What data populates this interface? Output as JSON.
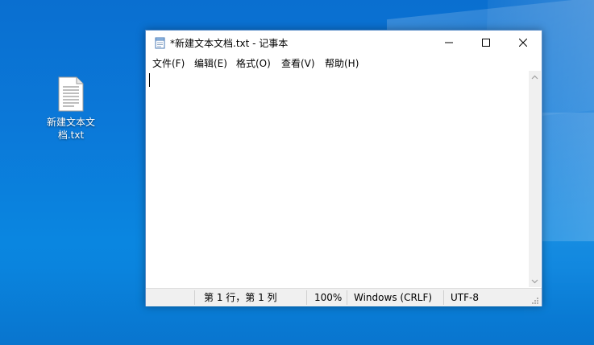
{
  "desktop": {
    "icon_label": "新建文本文档.txt"
  },
  "window": {
    "title": "*新建文本文档.txt - 记事本",
    "icons": {
      "app": "notepad-icon",
      "minimize": "minimize-icon",
      "maximize": "maximize-icon",
      "close": "close-icon"
    }
  },
  "menu": {
    "items": [
      "文件(F)",
      "编辑(E)",
      "格式(O)",
      "查看(V)",
      "帮助(H)"
    ]
  },
  "editor": {
    "content": ""
  },
  "status": {
    "position": "第 1 行，第 1 列",
    "zoom": "100%",
    "line_ending": "Windows (CRLF)",
    "encoding": "UTF-8"
  },
  "colors": {
    "desktop_bg": "#0a78d8",
    "window_border": "#5d8fc9",
    "statusbar_bg": "#f0f0f0"
  }
}
